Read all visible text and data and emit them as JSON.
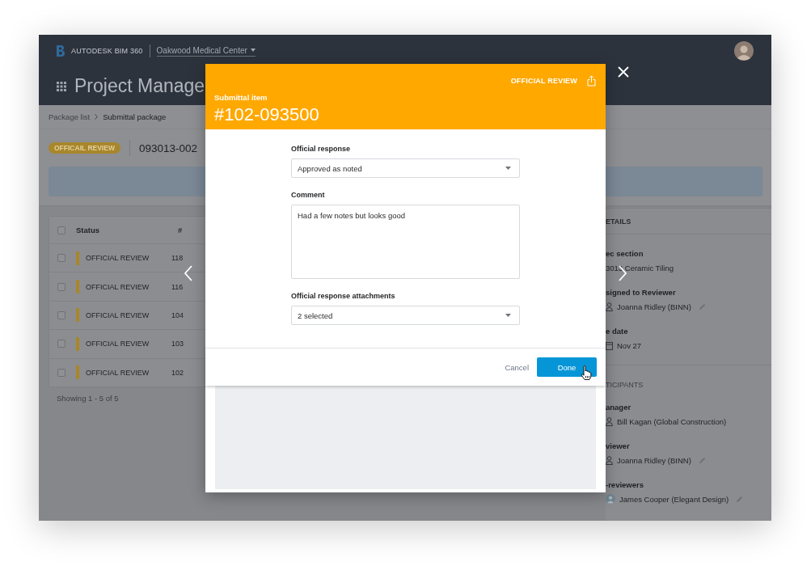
{
  "app_header": {
    "product": "AUTODESK BIM 360",
    "project": "Oakwood Medical Center",
    "page_title": "Project Manage"
  },
  "breadcrumb": [
    {
      "label": "Package list",
      "current": false
    },
    {
      "label": "Submittal package",
      "current": true
    }
  ],
  "package": {
    "status": "OFFICAIL REVIEW",
    "number": "093013-002"
  },
  "table": {
    "select_all_checked": false,
    "columns": [
      "Status",
      "#"
    ],
    "rows": [
      {
        "checked": false,
        "status": "OFFICIAL REVIEW",
        "number": "118"
      },
      {
        "checked": false,
        "status": "OFFICIAL REVIEW",
        "number": "116"
      },
      {
        "checked": false,
        "status": "OFFICIAL REVIEW",
        "number": "104"
      },
      {
        "checked": false,
        "status": "OFFICIAL REVIEW",
        "number": "103"
      },
      {
        "checked": false,
        "status": "OFFICIAL REVIEW",
        "number": "102"
      }
    ],
    "footer": "Showing 1 - 5 of 5"
  },
  "details_panel": {
    "title": "ETAILS",
    "fields": [
      {
        "kind": "text",
        "label": "ec section",
        "value": "3013 Ceramic Tiling",
        "editable": false
      },
      {
        "kind": "person",
        "label": "signed to Reviewer",
        "value": "Joanna Ridley (BINN)",
        "editable": true
      },
      {
        "kind": "date",
        "label": "e date",
        "value": "Nov 27",
        "editable": false
      }
    ]
  },
  "participants_panel": {
    "title": "TICIPANTS",
    "fields": [
      {
        "kind": "person",
        "label": "anager",
        "value": "Bill Kagan (Global Construction)",
        "editable": false
      },
      {
        "kind": "person",
        "label": "viewer",
        "value": "Joanna Ridley (BINN)",
        "editable": true
      },
      {
        "kind": "avatar",
        "label": "-reviewers",
        "value": "James Cooper (Elegant Design)",
        "editable": true
      }
    ]
  },
  "modal": {
    "eyebrow": "Submittal item",
    "title": "#102-093500",
    "status": "OFFICIAL REVIEW",
    "fields": [
      {
        "kind": "select",
        "label": "Official response",
        "value": "Approved as noted"
      },
      {
        "kind": "textarea",
        "label": "Comment",
        "value": "Had a few notes but looks good"
      },
      {
        "kind": "select",
        "label": "Official response attachments",
        "value": "2 selected"
      }
    ],
    "buttons": [
      {
        "kind": "secondary",
        "label": "Cancel"
      },
      {
        "kind": "primary",
        "label": "Done"
      }
    ]
  }
}
